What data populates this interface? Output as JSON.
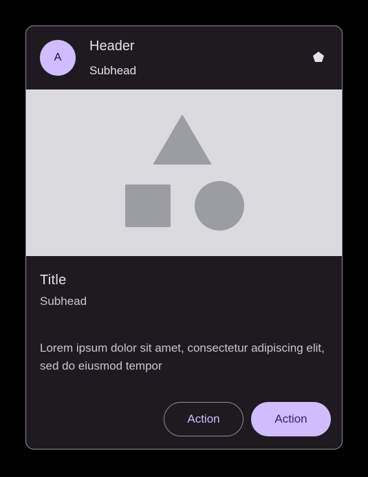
{
  "card": {
    "header": {
      "avatar_letter": "A",
      "title": "Header",
      "subtitle": "Subhead",
      "overflow_icon": "pentagon-icon"
    },
    "media": {
      "shapes": [
        "triangle-shape",
        "square-shape",
        "circle-shape"
      ]
    },
    "content": {
      "title": "Title",
      "subtitle": "Subhead",
      "body": "Lorem ipsum dolor sit amet, consectetur adipiscing elit, sed do eiusmod tempor"
    },
    "actions": {
      "secondary_label": "Action",
      "primary_label": "Action"
    }
  },
  "colors": {
    "surface": "#1d1b20",
    "outline": "#938f99",
    "primary": "#d0bcff",
    "on_primary": "#381e72",
    "media_bg": "#dadadf",
    "shape_fill": "#9a9da2"
  }
}
